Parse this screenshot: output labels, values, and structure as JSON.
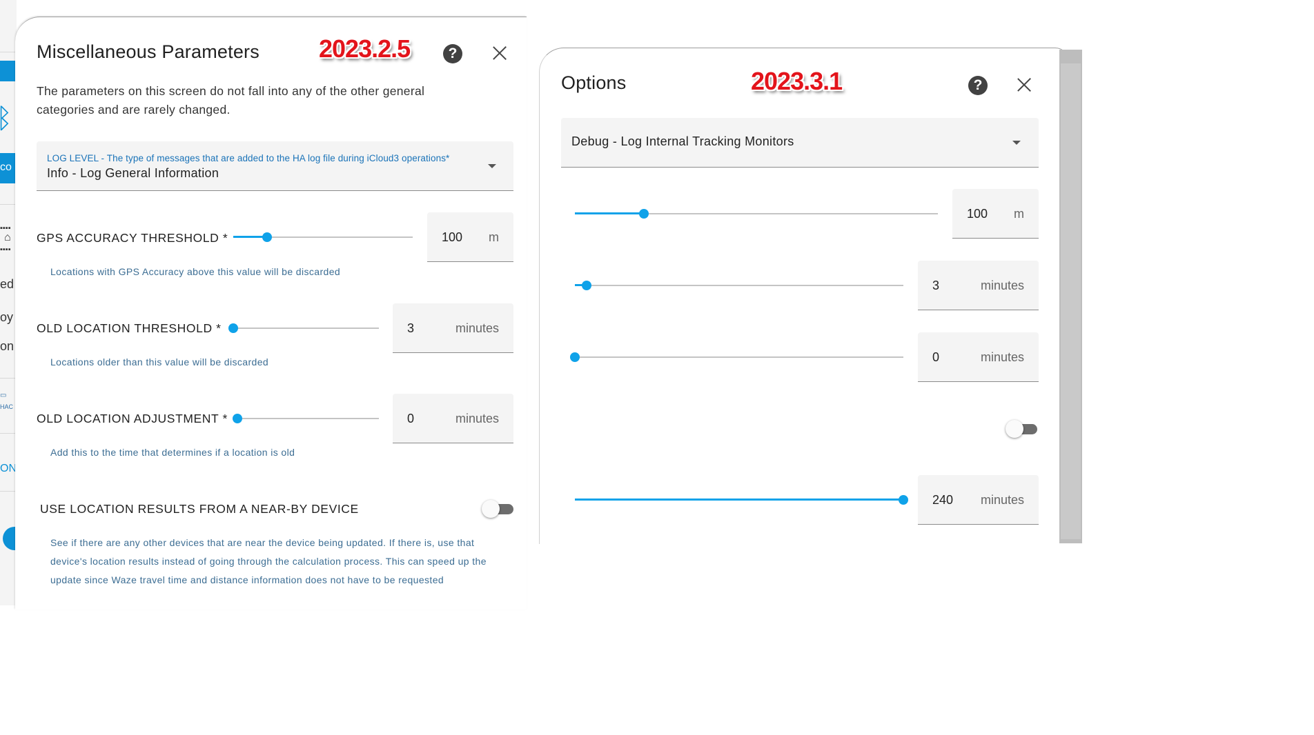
{
  "background_fragments": {
    "t1": "co",
    "t2": "ed",
    "t3": "oy",
    "t4": "on",
    "t5": "ON",
    "t6": "HAC"
  },
  "left_dialog": {
    "title": "Miscellaneous Parameters",
    "version_badge": "2023.2.5",
    "help_icon_glyph": "?",
    "description": "The parameters on this screen do not fall into any of the other general categories and are rarely changed.",
    "log_level": {
      "label": "LOG LEVEL - The type of messages that are added to the HA log file during iCloud3 operations*",
      "value": "Info - Log General Information"
    },
    "gps_accuracy": {
      "label": "GPS ACCURACY THRESHOLD *",
      "value": "100",
      "unit": "m",
      "slider_fraction": 0.19,
      "helper": "Locations with GPS Accuracy above this value will be discarded"
    },
    "old_location_threshold": {
      "label": "OLD LOCATION THRESHOLD *",
      "value": "3",
      "unit": "minutes",
      "slider_fraction": 0.0,
      "helper": "Locations older than this value will be discarded"
    },
    "old_location_adjustment": {
      "label": "OLD LOCATION ADJUSTMENT *",
      "value": "0",
      "unit": "minutes",
      "slider_fraction": 0.0,
      "helper": "Add this to the time that determines if a location is old"
    },
    "nearby_device": {
      "label": "USE LOCATION RESULTS FROM A NEAR-BY DEVICE",
      "enabled": false,
      "helper": "See if there are any other devices that are near the device being updated. If there is, use that device's location results instead of going through the calculation process. This can speed up the update since Waze travel time and distance information does not have to be requested"
    }
  },
  "right_dialog": {
    "title": "Options",
    "version_badge": "2023.3.1",
    "help_icon_glyph": "?",
    "log_level_value": "Debug - Log Internal Tracking Monitors",
    "gps_accuracy": {
      "value": "100",
      "unit": "m",
      "slider_fraction": 0.19
    },
    "old_location_threshold": {
      "value": "3",
      "unit": "minutes",
      "slider_fraction": 0.035
    },
    "old_location_adjustment": {
      "value": "0",
      "unit": "minutes",
      "slider_fraction": 0.0
    },
    "nearby_device": {
      "enabled": false
    },
    "last_field": {
      "value": "240",
      "unit": "minutes",
      "slider_fraction": 1.0
    }
  },
  "colors": {
    "accent": "#0fa2e9",
    "version_red": "#e3141b",
    "helper_blue": "#3c6d93",
    "select_label_blue": "#1a73b8"
  }
}
